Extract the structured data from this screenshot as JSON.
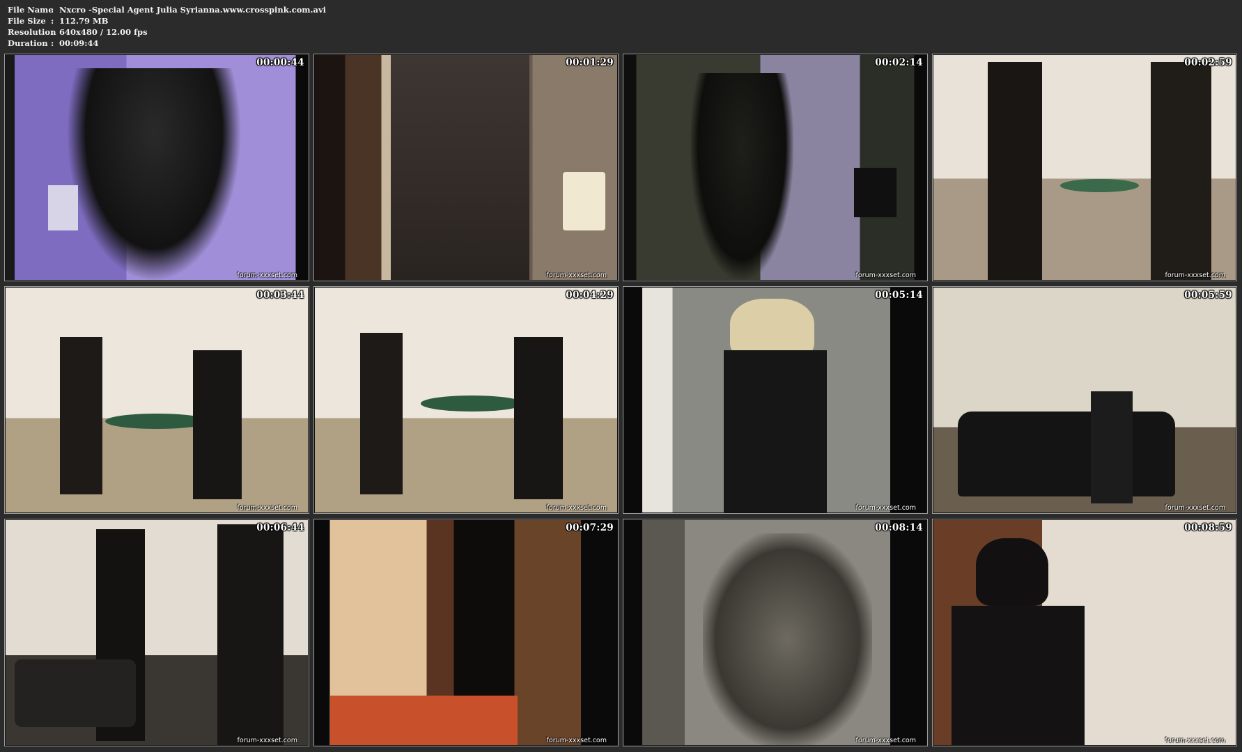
{
  "info": {
    "file_name_label": "File Name",
    "file_name": "Nxcro -Special Agent Julia Syrianna.www.crosspink.com.avi",
    "file_size_label": "File Size",
    "file_size": "112.79 MB",
    "resolution_label": "Resolution",
    "resolution": "640x480 / 12.00 fps",
    "duration_label": "Duration",
    "duration": "00:09:44",
    "separator": ":"
  },
  "watermark": "forum-xxxset.com",
  "thumbnails": [
    {
      "timestamp": "00:00:44"
    },
    {
      "timestamp": "00:01:29"
    },
    {
      "timestamp": "00:02:14"
    },
    {
      "timestamp": "00:02:59"
    },
    {
      "timestamp": "00:03:44"
    },
    {
      "timestamp": "00:04:29"
    },
    {
      "timestamp": "00:05:14"
    },
    {
      "timestamp": "00:05:59"
    },
    {
      "timestamp": "00:06:44"
    },
    {
      "timestamp": "00:07:29"
    },
    {
      "timestamp": "00:08:14"
    },
    {
      "timestamp": "00:08:59"
    }
  ]
}
